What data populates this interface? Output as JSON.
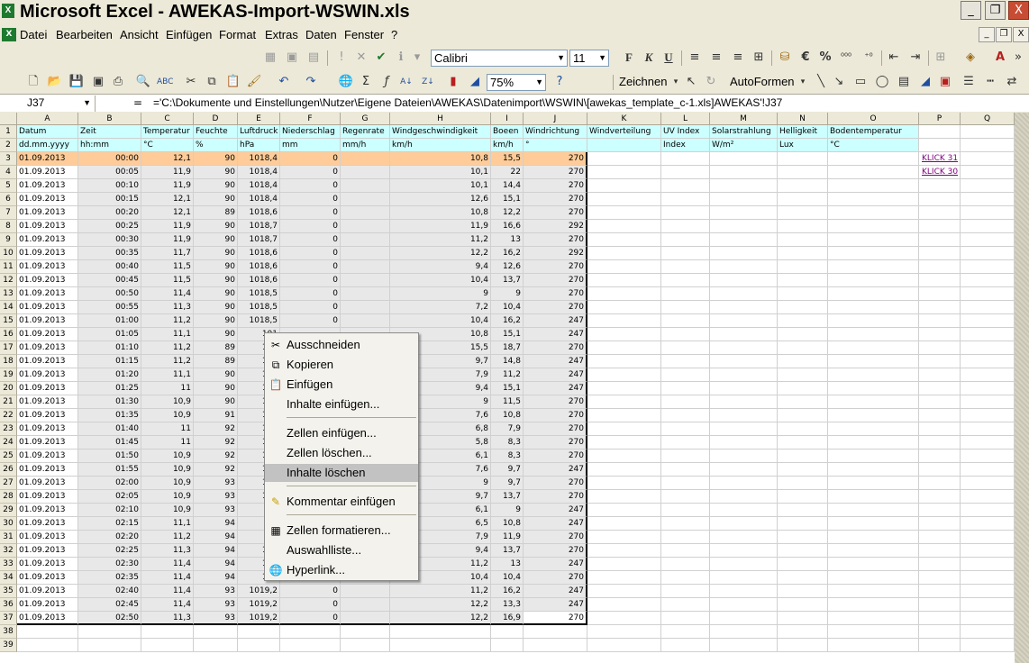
{
  "window": {
    "title": "Microsoft Excel - AWEKAS-Import-WSWIN.xls",
    "app_icon": "X",
    "buttons": {
      "minimize": "_",
      "restore": "❐",
      "close": "X"
    }
  },
  "menubar": {
    "items": [
      "Datei",
      "Bearbeiten",
      "Ansicht",
      "Einfügen",
      "Format",
      "Extras",
      "Daten",
      "Fenster",
      "?"
    ],
    "doc_buttons": [
      "_",
      "❐",
      "X"
    ]
  },
  "toolbar_format": {
    "font": "Calibri",
    "size": "11",
    "bold": "F",
    "italic": "K",
    "underline": "U",
    "euro": "€",
    "percent": "%"
  },
  "toolbar_standard": {
    "zoom": "75%",
    "draw_label": "Zeichnen",
    "autoshapes_label": "AutoFormen"
  },
  "formula_bar": {
    "name_box": "J37",
    "equals": "=",
    "formula": "='C:\\Dokumente und Einstellungen\\Nutzer\\Eigene Dateien\\AWEKAS\\Datenimport\\WSWIN\\[awekas_template_c-1.xls]AWEKAS'!J37"
  },
  "columns": [
    "A",
    "B",
    "C",
    "D",
    "E",
    "F",
    "G",
    "H",
    "I",
    "J",
    "K",
    "L",
    "M",
    "N",
    "O",
    "P",
    "Q"
  ],
  "header_row1": [
    "Datum",
    "Zeit",
    "Temperatur",
    "Feuchte",
    "Luftdruck",
    "Niederschlag",
    "Regenrate",
    "Windgeschwindigkeit",
    "Boeen",
    "Windrichtung",
    "Windverteilung",
    "UV Index",
    "Solarstrahlung",
    "Helligkeit",
    "Bodentemperatur"
  ],
  "header_row2": [
    "dd.mm.yyyy",
    "hh:mm",
    "°C",
    "%",
    "hPa",
    "mm",
    "mm/h",
    "km/h",
    "km/h",
    "°",
    "",
    "Index",
    "W/m²",
    "Lux",
    "°C"
  ],
  "links": [
    "KLICK 31",
    "KLICK 30"
  ],
  "rows": [
    [
      "01.09.2013",
      "00:00",
      "12,1",
      "90",
      "1018,4",
      "0",
      "",
      "10,8",
      "15,5",
      "270"
    ],
    [
      "01.09.2013",
      "00:05",
      "11,9",
      "90",
      "1018,4",
      "0",
      "",
      "10,1",
      "22",
      "270"
    ],
    [
      "01.09.2013",
      "00:10",
      "11,9",
      "90",
      "1018,4",
      "0",
      "",
      "10,1",
      "14,4",
      "270"
    ],
    [
      "01.09.2013",
      "00:15",
      "12,1",
      "90",
      "1018,4",
      "0",
      "",
      "12,6",
      "15,1",
      "270"
    ],
    [
      "01.09.2013",
      "00:20",
      "12,1",
      "89",
      "1018,6",
      "0",
      "",
      "10,8",
      "12,2",
      "270"
    ],
    [
      "01.09.2013",
      "00:25",
      "11,9",
      "90",
      "1018,7",
      "0",
      "",
      "11,9",
      "16,6",
      "292"
    ],
    [
      "01.09.2013",
      "00:30",
      "11,9",
      "90",
      "1018,7",
      "0",
      "",
      "11,2",
      "13",
      "270"
    ],
    [
      "01.09.2013",
      "00:35",
      "11,7",
      "90",
      "1018,6",
      "0",
      "",
      "12,2",
      "16,2",
      "292"
    ],
    [
      "01.09.2013",
      "00:40",
      "11,5",
      "90",
      "1018,6",
      "0",
      "",
      "9,4",
      "12,6",
      "270"
    ],
    [
      "01.09.2013",
      "00:45",
      "11,5",
      "90",
      "1018,6",
      "0",
      "",
      "10,4",
      "13,7",
      "270"
    ],
    [
      "01.09.2013",
      "00:50",
      "11,4",
      "90",
      "1018,5",
      "0",
      "",
      "9",
      "9",
      "270"
    ],
    [
      "01.09.2013",
      "00:55",
      "11,3",
      "90",
      "1018,5",
      "0",
      "",
      "7,2",
      "10,4",
      "270"
    ],
    [
      "01.09.2013",
      "01:00",
      "11,2",
      "90",
      "1018,5",
      "0",
      "",
      "10,4",
      "16,2",
      "247"
    ],
    [
      "01.09.2013",
      "01:05",
      "11,1",
      "90",
      "101",
      "",
      "",
      "10,8",
      "15,1",
      "247"
    ],
    [
      "01.09.2013",
      "01:10",
      "11,2",
      "89",
      "101",
      "",
      "",
      "15,5",
      "18,7",
      "270"
    ],
    [
      "01.09.2013",
      "01:15",
      "11,2",
      "89",
      "101",
      "",
      "",
      "9,7",
      "14,8",
      "247"
    ],
    [
      "01.09.2013",
      "01:20",
      "11,1",
      "90",
      "101",
      "",
      "",
      "7,9",
      "11,2",
      "247"
    ],
    [
      "01.09.2013",
      "01:25",
      "11",
      "90",
      "101",
      "",
      "",
      "9,4",
      "15,1",
      "247"
    ],
    [
      "01.09.2013",
      "01:30",
      "10,9",
      "90",
      "101",
      "",
      "",
      "9",
      "11,5",
      "270"
    ],
    [
      "01.09.2013",
      "01:35",
      "10,9",
      "91",
      "101",
      "",
      "",
      "7,6",
      "10,8",
      "270"
    ],
    [
      "01.09.2013",
      "01:40",
      "11",
      "92",
      "101",
      "",
      "",
      "6,8",
      "7,9",
      "270"
    ],
    [
      "01.09.2013",
      "01:45",
      "11",
      "92",
      "101",
      "",
      "",
      "5,8",
      "8,3",
      "270"
    ],
    [
      "01.09.2013",
      "01:50",
      "10,9",
      "92",
      "101",
      "",
      "",
      "6,1",
      "8,3",
      "270"
    ],
    [
      "01.09.2013",
      "01:55",
      "10,9",
      "92",
      "101",
      "",
      "",
      "7,6",
      "9,7",
      "247"
    ],
    [
      "01.09.2013",
      "02:00",
      "10,9",
      "93",
      "101",
      "",
      "",
      "9",
      "9,7",
      "270"
    ],
    [
      "01.09.2013",
      "02:05",
      "10,9",
      "93",
      "101",
      "",
      "",
      "9,7",
      "13,7",
      "270"
    ],
    [
      "01.09.2013",
      "02:10",
      "10,9",
      "93",
      "1",
      "",
      "",
      "6,1",
      "9",
      "247"
    ],
    [
      "01.09.2013",
      "02:15",
      "11,1",
      "94",
      "1",
      "",
      "",
      "6,5",
      "10,8",
      "247"
    ],
    [
      "01.09.2013",
      "02:20",
      "11,2",
      "94",
      "1",
      "",
      "",
      "7,9",
      "11,9",
      "270"
    ],
    [
      "01.09.2013",
      "02:25",
      "11,3",
      "94",
      "101",
      "",
      "",
      "9,4",
      "13,7",
      "270"
    ],
    [
      "01.09.2013",
      "02:30",
      "11,4",
      "94",
      "101",
      "",
      "",
      "11,2",
      "13",
      "247"
    ],
    [
      "01.09.2013",
      "02:35",
      "11,4",
      "94",
      "101",
      "",
      "",
      "10,4",
      "10,4",
      "270"
    ],
    [
      "01.09.2013",
      "02:40",
      "11,4",
      "93",
      "1019,2",
      "0",
      "",
      "11,2",
      "16,2",
      "247"
    ],
    [
      "01.09.2013",
      "02:45",
      "11,4",
      "93",
      "1019,2",
      "0",
      "",
      "12,2",
      "13,3",
      "247"
    ],
    [
      "01.09.2013",
      "02:50",
      "11,3",
      "93",
      "1019,2",
      "0",
      "",
      "12,2",
      "16,9",
      "270"
    ]
  ],
  "context_menu": {
    "items": [
      "Ausschneiden",
      "Kopieren",
      "Einfügen",
      "Inhalte einfügen...",
      "Zellen einfügen...",
      "Zellen löschen...",
      "Inhalte löschen",
      "Kommentar einfügen",
      "Zellen formatieren...",
      "Auswahlliste...",
      "Hyperlink..."
    ],
    "highlighted": "Inhalte löschen"
  }
}
